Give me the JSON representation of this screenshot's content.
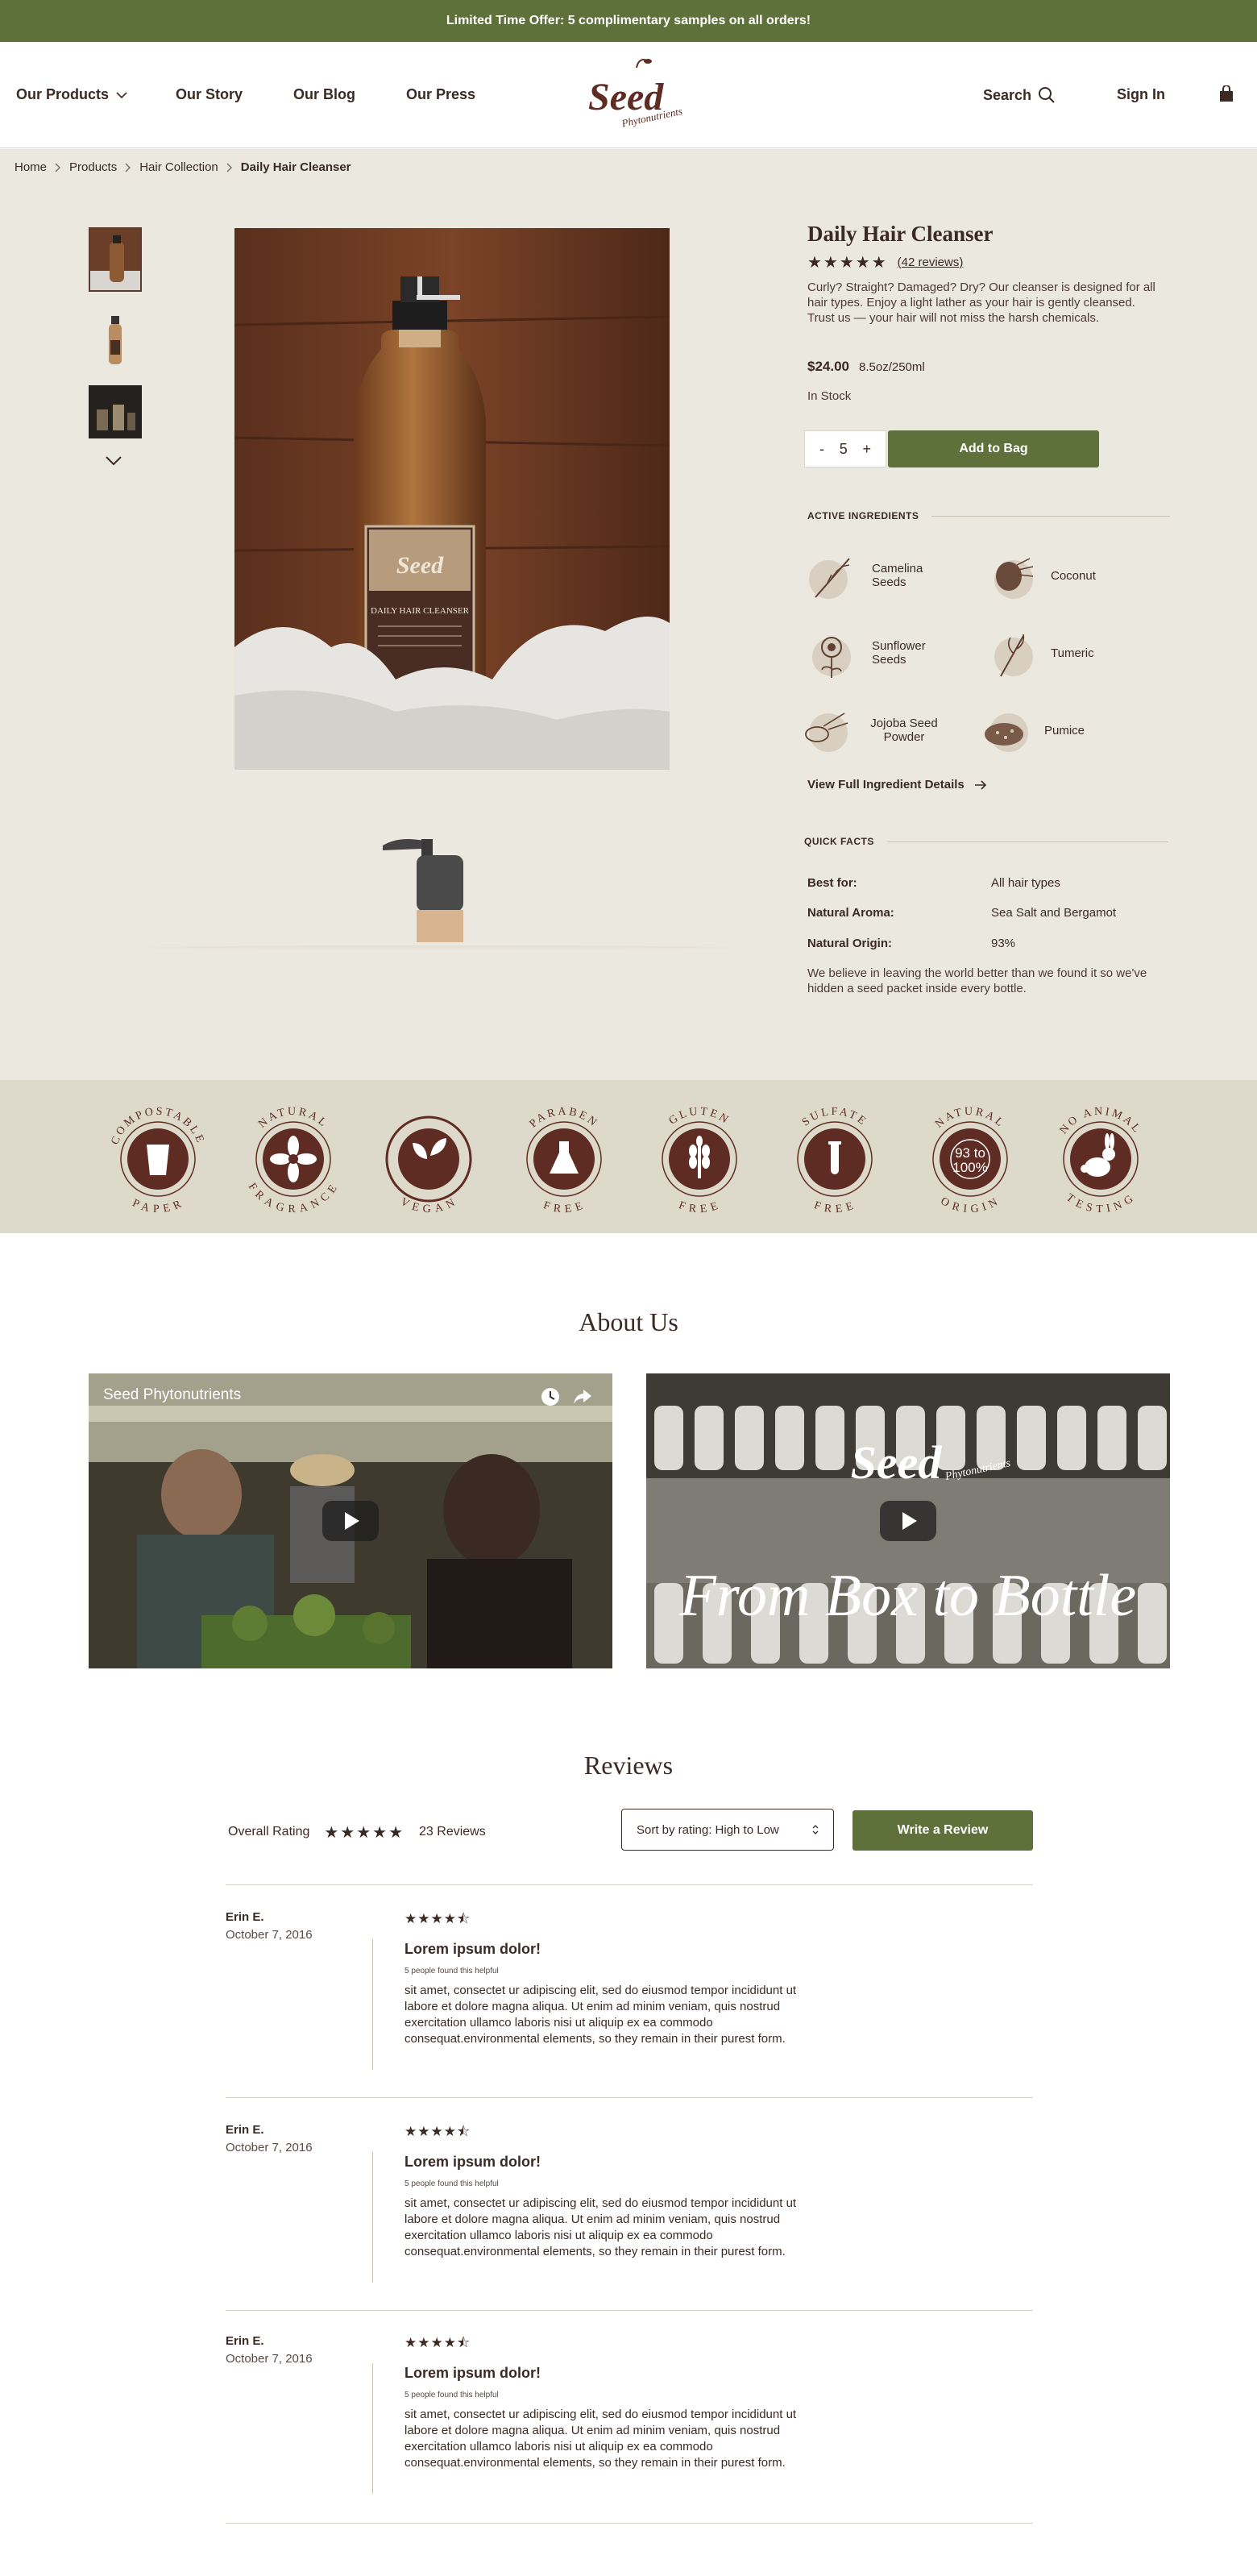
{
  "promo": {
    "text": "Limited Time Offer: 5 complimentary samples on all orders!"
  },
  "header": {
    "nav": [
      "Our Products",
      "Our Story",
      "Our Blog",
      "Our Press"
    ],
    "logo_text": "Seed",
    "logo_sub": "Phytonutrients",
    "search_label": "Search",
    "signin_label": "Sign In"
  },
  "breadcrumb": [
    "Home",
    "Products",
    "Hair Collection",
    "Daily Hair Cleanser"
  ],
  "product": {
    "title": "Daily Hair Cleanser",
    "stars": "★★★★★",
    "reviews_link": "(42 reviews)",
    "description": "Curly? Straight? Damaged? Dry? Our cleanser is designed for all hair types. Enjoy a light lather as your hair is gently cleansed. Trust us — your hair will not miss the harsh chemicals.",
    "price": "$24.00",
    "size": "8.5oz/250ml",
    "stock": "In Stock",
    "qty_minus": "-",
    "qty_value": "5",
    "qty_plus": "+",
    "add_button": "Add to Bag",
    "label_brand": "Seed",
    "label_name": "DAILY HAIR CLEANSER"
  },
  "ingredients": {
    "heading": "ACTIVE INGREDIENTS",
    "items": [
      "Camelina Seeds",
      "Coconut",
      "Sunflower Seeds",
      "Tumeric",
      "Jojoba Seed Powder",
      "Pumice"
    ],
    "link": "View Full Ingredient Details"
  },
  "facts": {
    "heading": "QUICK FACTS",
    "rows": [
      {
        "k": "Best for:",
        "v": "All hair types"
      },
      {
        "k": "Natural Aroma:",
        "v": "Sea Salt and Bergamot"
      },
      {
        "k": "Natural Origin:",
        "v": "93%"
      }
    ],
    "note": "We believe in leaving the world better than we found it so we've hidden a seed packet inside every bottle."
  },
  "badges": [
    {
      "top": "COMPOSTABLE",
      "bottom": "PAPER",
      "icon": "cup-icon"
    },
    {
      "top": "NATURAL",
      "bottom": "FRAGRANCE",
      "icon": "flower-icon"
    },
    {
      "top": "",
      "bottom": "VEGAN",
      "icon": "leaves-icon"
    },
    {
      "top": "PARABEN",
      "bottom": "FREE",
      "icon": "flask-icon"
    },
    {
      "top": "GLUTEN",
      "bottom": "FREE",
      "icon": "wheat-icon"
    },
    {
      "top": "SULFATE",
      "bottom": "FREE",
      "icon": "test-tube-icon"
    },
    {
      "top": "NATURAL",
      "bottom": "ORIGIN",
      "icon": "percent-icon",
      "inner1": "93 to",
      "inner2": "100%"
    },
    {
      "top": "NO ANIMAL",
      "bottom": "TESTING",
      "icon": "rabbit-icon"
    }
  ],
  "about": {
    "title": "About Us",
    "video1_title": "Seed Phytonutrients",
    "video2_logo": "Seed",
    "video2_sub": "Phytonutrients",
    "video2_caption": "From Box to Bottle"
  },
  "reviews": {
    "title": "Reviews",
    "overall_label": "Overall Rating",
    "overall_stars": "★★★★★",
    "count": "23 Reviews",
    "sort": "Sort by rating: High to Low",
    "write_button": "Write a Review",
    "items": [
      {
        "author": "Erin E.",
        "date": "October 7, 2016",
        "stars": "★★★★⯪",
        "title": "Lorem ipsum dolor!",
        "helpful": "5 people found this helpful",
        "body": "sit amet, consectet ur adipiscing elit, sed do eiusmod tempor incididunt ut labore et dolore magna aliqua. Ut enim ad minim veniam, quis nostrud exercitation ullamco laboris nisi ut aliquip ex ea commodo consequat.environmental elements, so they remain in their purest form."
      },
      {
        "author": "Erin E.",
        "date": "October 7, 2016",
        "stars": "★★★★⯪",
        "title": "Lorem ipsum dolor!",
        "helpful": "5 people found this helpful",
        "body": "sit amet, consectet ur adipiscing elit, sed do eiusmod tempor incididunt ut labore et dolore magna aliqua. Ut enim ad minim veniam, quis nostrud exercitation ullamco laboris nisi ut aliquip ex ea commodo consequat.environmental elements, so they remain in their purest form."
      },
      {
        "author": "Erin E.",
        "date": "October 7, 2016",
        "stars": "★★★★⯪",
        "title": "Lorem ipsum dolor!",
        "helpful": "5 people found this helpful",
        "body": "sit amet, consectet ur adipiscing elit, sed do eiusmod tempor incididunt ut labore et dolore magna aliqua. Ut enim ad minim veniam, quis nostrud exercitation ullamco laboris nisi ut aliquip ex ea commodo consequat.environmental elements, so they remain in their purest form."
      }
    ]
  },
  "colors": {
    "brand_green": "#5f713a",
    "brown": "#3b2a23",
    "badge_brown": "#5e2c22",
    "beige": "#ebe8df",
    "badge_band": "#dedacb"
  }
}
